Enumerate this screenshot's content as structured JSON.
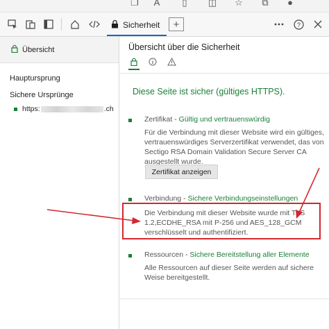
{
  "browser_strip": {
    "icons": [
      "read-aloud-icon",
      "text-icon",
      "split-screen-icon",
      "favorites-icon",
      "collections-icon",
      "profile-icon"
    ]
  },
  "toolbar": {
    "tab_label": "Sicherheit",
    "icons": [
      "inspect-icon",
      "device-emulation-icon",
      "dock-icon",
      "home-icon",
      "source-code-icon",
      "lock-icon",
      "add-tab-icon",
      "more-icon",
      "help-icon",
      "close-icon"
    ]
  },
  "sidebar": {
    "overview_label": "Übersicht",
    "main_origin_heading": "Hauptursprung",
    "secure_origins_heading": "Sichere Ursprünge",
    "origin_prefix": "https:",
    "origin_suffix": ".ch"
  },
  "main": {
    "title": "Übersicht über die Sicherheit",
    "secure_banner": "Diese Seite ist sicher (gültiges HTTPS).",
    "certificate": {
      "name": "Zertifikat",
      "separator": " - ",
      "status": "Gültig und vertrauenswürdig",
      "description": "Für die Verbindung mit dieser Website wird ein gültiges, vertrauenswürdiges Serverzertifikat verwendet, das von Sectigo RSA Domain Validation Secure Server CA ausgestellt wurde.",
      "button_label": "Zertifikat anzeigen"
    },
    "connection": {
      "name": "Verbindung",
      "separator": " - ",
      "status": "Sichere Verbindungseinstellungen",
      "description": "Die Verbindung mit dieser Website wurde mit TLS 1.2,ECDHE_RSA mit P-256 und AES_128_GCM verschlüsselt und authentifiziert."
    },
    "resources": {
      "name": "Ressourcen",
      "separator": " - ",
      "status": "Sichere Bereitstellung aller Elemente",
      "description": "Alle Ressourcen auf dieser Seite werden auf sichere Weise bereitgestellt."
    }
  },
  "colors": {
    "secure_green": "#1a7f37",
    "annotation_red": "#d4262e",
    "tab_accent": "#0f6cbd"
  }
}
